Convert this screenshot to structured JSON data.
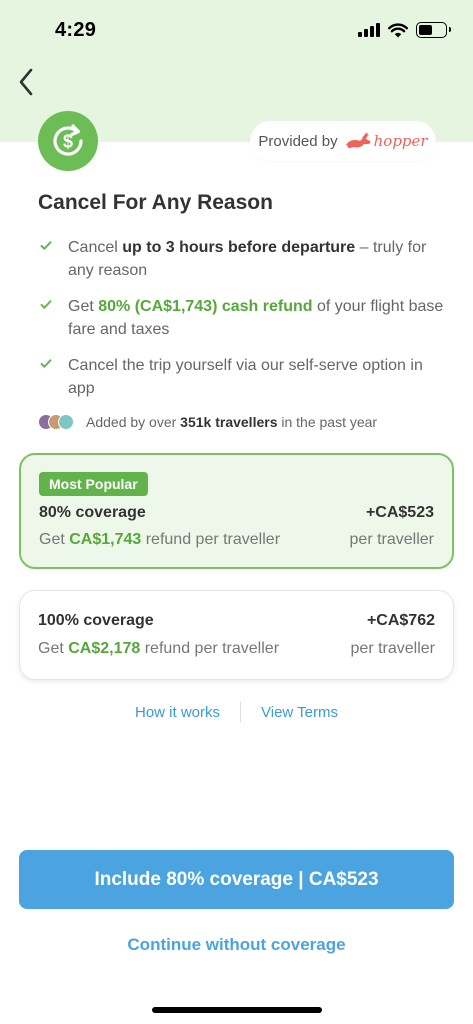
{
  "status_bar": {
    "time": "4:29",
    "battery_level": 0.5
  },
  "colors": {
    "header_bg": "#e5f5df",
    "accent_green": "#56a83a",
    "primary_blue": "#4ba4df",
    "hopper_red": "#f2625a"
  },
  "header": {
    "back_icon": "chevron-left-icon",
    "product_icon": "cash-refund-icon",
    "provided_by_label": "Provided by",
    "provider_name": "hopper"
  },
  "title": "Cancel For Any Reason",
  "benefits": [
    {
      "pre": "Cancel ",
      "highlight": "up to 3 hours before departure",
      "post": " – truly for any reason"
    },
    {
      "pre": "Get ",
      "highlight": "80% (CA$1,743) cash refund",
      "post": " of your flight base fare and taxes"
    },
    {
      "pre": "Cancel the trip yourself via our self-serve option in app",
      "highlight": "",
      "post": ""
    }
  ],
  "social_proof": {
    "pre": "Added by over ",
    "highlight": "351k travellers",
    "post": " in the past year"
  },
  "options": [
    {
      "badge": "Most Popular",
      "name": "80% coverage",
      "desc_pre": "Get ",
      "desc_amount": "CA$1,743",
      "desc_post": " refund per traveller",
      "price": "+CA$523",
      "price_unit": "per traveller",
      "selected": true
    },
    {
      "name": "100% coverage",
      "desc_pre": "Get ",
      "desc_amount": "CA$2,178",
      "desc_post": " refund per traveller",
      "price": "+CA$762",
      "price_unit": "per traveller",
      "selected": false
    }
  ],
  "links": {
    "how_it_works": "How it works",
    "view_terms": "View Terms"
  },
  "cta": {
    "label": "Include 80% coverage | CA$523"
  },
  "secondary_action": {
    "label": "Continue without coverage"
  }
}
